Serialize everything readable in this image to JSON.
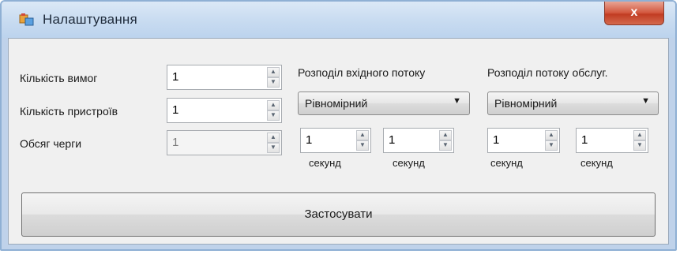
{
  "window": {
    "title": "Налаштування",
    "close_label": "x"
  },
  "fields": {
    "requests_count": {
      "label": "Кількість вимог",
      "value": "1"
    },
    "devices_count": {
      "label": "Кількість пристроїв",
      "value": "1"
    },
    "queue_size": {
      "label": "Обсяг черги",
      "value": "1"
    }
  },
  "input_flow": {
    "label": "Розподіл вхідного потоку",
    "selected": "Рівномірний",
    "min": {
      "value": "1",
      "unit": "секунд"
    },
    "max": {
      "value": "1",
      "unit": "секунд"
    }
  },
  "service_flow": {
    "label": "Розподіл потоку обслуг.",
    "selected": "Рівномірний",
    "min": {
      "value": "1",
      "unit": "секунд"
    },
    "max": {
      "value": "1",
      "unit": "секунд"
    }
  },
  "apply_label": "Застосувати",
  "colors": {
    "titlebar": "#c9dcf1",
    "close_button": "#c13b22",
    "client_background": "#f0f0f0"
  },
  "icons": {
    "app": "settings-app-icon",
    "spin_up": "spin-up-arrow-icon",
    "spin_down": "spin-down-arrow-icon",
    "dropdown": "dropdown-arrow-icon"
  }
}
